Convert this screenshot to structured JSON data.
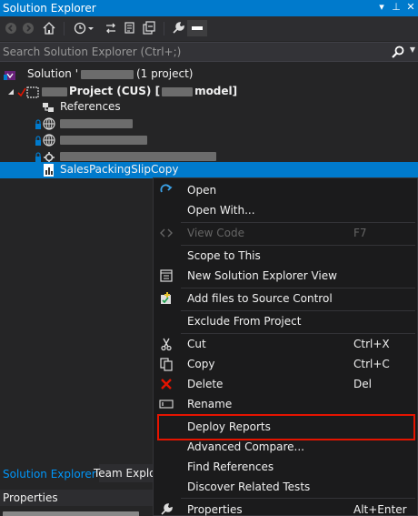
{
  "window": {
    "title": "Solution Explorer",
    "controls": [
      "▾",
      "⊥",
      "✕"
    ]
  },
  "toolbar": {
    "icons": [
      "back-icon",
      "forward-icon",
      "home-icon",
      "history-icon",
      "sync-icon",
      "pending-changes-icon",
      "collapse-all-icon",
      "properties-wrench-icon",
      "preview-icon"
    ]
  },
  "search": {
    "placeholder": "Search Solution Explorer (Ctrl+;)"
  },
  "tree": {
    "solution_label": "Solution '",
    "solution_suffix": "(1 project)",
    "project_label": "Project (CUS) [",
    "project_suffix": "model]",
    "references_label": "References",
    "selected_item": "SalesPackingSlipCopy"
  },
  "bottom": {
    "tab_solution_explorer": "Solution Explorer",
    "tab_team_explorer": "Team Explore",
    "properties_title": "Properties"
  },
  "context_menu": {
    "items": [
      {
        "label": "Open",
        "shortcut": "",
        "icon": "open-icon",
        "enabled": true
      },
      {
        "label": "Open With...",
        "shortcut": "",
        "icon": "",
        "enabled": true
      },
      {
        "label": "View Code",
        "shortcut": "F7",
        "icon": "view-code-icon",
        "enabled": false
      },
      {
        "label": "Scope to This",
        "shortcut": "",
        "icon": "",
        "enabled": true
      },
      {
        "label": "New Solution Explorer View",
        "shortcut": "",
        "icon": "new-view-icon",
        "enabled": true
      },
      {
        "label": "Add files to Source Control",
        "shortcut": "",
        "icon": "source-control-add-icon",
        "enabled": true
      },
      {
        "label": "Exclude From Project",
        "shortcut": "",
        "icon": "",
        "enabled": true
      },
      {
        "label": "Cut",
        "shortcut": "Ctrl+X",
        "icon": "cut-icon",
        "enabled": true
      },
      {
        "label": "Copy",
        "shortcut": "Ctrl+C",
        "icon": "copy-icon",
        "enabled": true
      },
      {
        "label": "Delete",
        "shortcut": "Del",
        "icon": "delete-icon",
        "enabled": true
      },
      {
        "label": "Rename",
        "shortcut": "",
        "icon": "rename-icon",
        "enabled": true
      },
      {
        "label": "Deploy Reports",
        "shortcut": "",
        "icon": "",
        "enabled": true,
        "highlighted": true
      },
      {
        "label": "Advanced Compare...",
        "shortcut": "",
        "icon": "",
        "enabled": true
      },
      {
        "label": "Find References",
        "shortcut": "",
        "icon": "",
        "enabled": true
      },
      {
        "label": "Discover Related Tests",
        "shortcut": "",
        "icon": "",
        "enabled": true
      },
      {
        "label": "Properties",
        "shortcut": "Alt+Enter",
        "icon": "properties-icon",
        "enabled": true
      }
    ]
  },
  "colors": {
    "accent": "#007acc",
    "highlight_border": "#e51400",
    "menu_bg": "#1b1b1c",
    "panel_bg": "#252526"
  }
}
